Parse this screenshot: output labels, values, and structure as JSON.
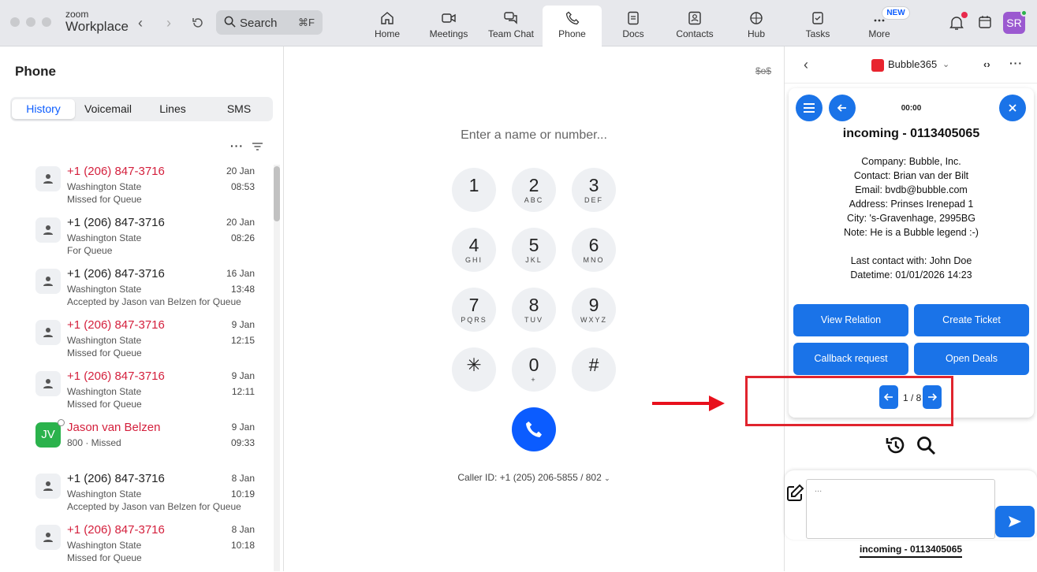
{
  "app": {
    "logo_small": "zoom",
    "logo_big": "Workplace",
    "search_label": "Search",
    "search_shortcut": "⌘F",
    "avatar_initials": "SR",
    "new_badge": "NEW"
  },
  "tabs": [
    {
      "label": "Home",
      "icon": "home-icon"
    },
    {
      "label": "Meetings",
      "icon": "video-icon"
    },
    {
      "label": "Team Chat",
      "icon": "chat-icon"
    },
    {
      "label": "Phone",
      "icon": "phone-icon",
      "active": true
    },
    {
      "label": "Docs",
      "icon": "doc-icon"
    },
    {
      "label": "Contacts",
      "icon": "contacts-icon"
    },
    {
      "label": "Hub",
      "icon": "hub-icon"
    },
    {
      "label": "Tasks",
      "icon": "tasks-icon"
    },
    {
      "label": "More",
      "icon": "more-icon"
    }
  ],
  "phone": {
    "title": "Phone",
    "subtabs": [
      "History",
      "Voicemail",
      "Lines",
      "SMS"
    ],
    "history": [
      {
        "name": "+1 (206) 847-3716",
        "missed": true,
        "line2": "Washington State",
        "line3": "Missed for Queue",
        "date": "20 Jan",
        "time": "08:53"
      },
      {
        "name": "+1 (206) 847-3716",
        "missed": false,
        "line2": "Washington State",
        "line3": "For Queue",
        "date": "20 Jan",
        "time": "08:26"
      },
      {
        "name": "+1 (206) 847-3716",
        "missed": false,
        "line2": "Washington State",
        "line3": "Accepted by Jason van Belzen for Queue",
        "date": "16 Jan",
        "time": "13:48"
      },
      {
        "name": "+1 (206) 847-3716",
        "missed": true,
        "line2": "Washington State",
        "line3": "Missed for Queue",
        "date": "9 Jan",
        "time": "12:15"
      },
      {
        "name": "+1 (206) 847-3716",
        "missed": true,
        "line2": "Washington State",
        "line3": "Missed for Queue",
        "date": "9 Jan",
        "time": "12:11"
      },
      {
        "name": "Jason van Belzen",
        "missed": true,
        "line2": "800 · Missed",
        "line3": "",
        "date": "9 Jan",
        "time": "09:33",
        "initials": "JV"
      },
      {
        "name": "+1 (206) 847-3716",
        "missed": false,
        "line2": "Washington State",
        "line3": "Accepted by Jason van Belzen for Queue",
        "date": "8 Jan",
        "time": "10:19"
      },
      {
        "name": "+1 (206) 847-3716",
        "missed": true,
        "line2": "Washington State",
        "line3": "Missed for Queue",
        "date": "8 Jan",
        "time": "10:18"
      }
    ]
  },
  "dialpad": {
    "placeholder": "Enter a name or number...",
    "keys": [
      {
        "d": "1",
        "s": ""
      },
      {
        "d": "2",
        "s": "ABC"
      },
      {
        "d": "3",
        "s": "DEF"
      },
      {
        "d": "4",
        "s": "GHI"
      },
      {
        "d": "5",
        "s": "JKL"
      },
      {
        "d": "6",
        "s": "MNO"
      },
      {
        "d": "7",
        "s": "PQRS"
      },
      {
        "d": "8",
        "s": "TUV"
      },
      {
        "d": "9",
        "s": "WXYZ"
      },
      {
        "d": "✳",
        "s": ""
      },
      {
        "d": "0",
        "s": "+"
      },
      {
        "d": "#",
        "s": ""
      }
    ],
    "caller_id": "Caller ID: +1 (205) 206-5855 / 802",
    "corner_text": "$o$"
  },
  "panel": {
    "app_name": "Bubble365",
    "timer": "00:00",
    "incoming": "incoming - 0113405065",
    "info": [
      "Company: Bubble, Inc.",
      "Contact: Brian van der Bilt",
      "Email: bvdb@bubble.com",
      "Address: Prinses Irenepad 1",
      "City: 's-Gravenhage, 2995BG",
      "Note: He is a Bubble legend :-)",
      "",
      "Last contact with: John Doe",
      "Datetime: 01/01/2026 14:23"
    ],
    "buttons": [
      "View Relation",
      "Create Ticket",
      "Callback request",
      "Open Deals"
    ],
    "pager": "1 / 8",
    "compose_placeholder": "...",
    "footer": "incoming - 0113405065"
  }
}
